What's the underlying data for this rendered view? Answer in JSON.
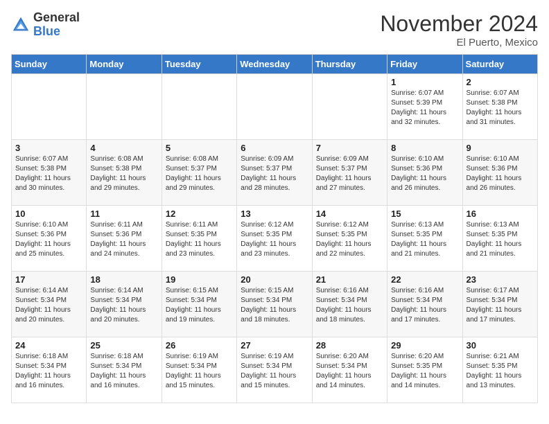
{
  "header": {
    "logo_general": "General",
    "logo_blue": "Blue",
    "month_title": "November 2024",
    "location": "El Puerto, Mexico"
  },
  "days_of_week": [
    "Sunday",
    "Monday",
    "Tuesday",
    "Wednesday",
    "Thursday",
    "Friday",
    "Saturday"
  ],
  "weeks": [
    [
      {
        "day": "",
        "info": ""
      },
      {
        "day": "",
        "info": ""
      },
      {
        "day": "",
        "info": ""
      },
      {
        "day": "",
        "info": ""
      },
      {
        "day": "",
        "info": ""
      },
      {
        "day": "1",
        "info": "Sunrise: 6:07 AM\nSunset: 5:39 PM\nDaylight: 11 hours\nand 32 minutes."
      },
      {
        "day": "2",
        "info": "Sunrise: 6:07 AM\nSunset: 5:38 PM\nDaylight: 11 hours\nand 31 minutes."
      }
    ],
    [
      {
        "day": "3",
        "info": "Sunrise: 6:07 AM\nSunset: 5:38 PM\nDaylight: 11 hours\nand 30 minutes."
      },
      {
        "day": "4",
        "info": "Sunrise: 6:08 AM\nSunset: 5:38 PM\nDaylight: 11 hours\nand 29 minutes."
      },
      {
        "day": "5",
        "info": "Sunrise: 6:08 AM\nSunset: 5:37 PM\nDaylight: 11 hours\nand 29 minutes."
      },
      {
        "day": "6",
        "info": "Sunrise: 6:09 AM\nSunset: 5:37 PM\nDaylight: 11 hours\nand 28 minutes."
      },
      {
        "day": "7",
        "info": "Sunrise: 6:09 AM\nSunset: 5:37 PM\nDaylight: 11 hours\nand 27 minutes."
      },
      {
        "day": "8",
        "info": "Sunrise: 6:10 AM\nSunset: 5:36 PM\nDaylight: 11 hours\nand 26 minutes."
      },
      {
        "day": "9",
        "info": "Sunrise: 6:10 AM\nSunset: 5:36 PM\nDaylight: 11 hours\nand 26 minutes."
      }
    ],
    [
      {
        "day": "10",
        "info": "Sunrise: 6:10 AM\nSunset: 5:36 PM\nDaylight: 11 hours\nand 25 minutes."
      },
      {
        "day": "11",
        "info": "Sunrise: 6:11 AM\nSunset: 5:36 PM\nDaylight: 11 hours\nand 24 minutes."
      },
      {
        "day": "12",
        "info": "Sunrise: 6:11 AM\nSunset: 5:35 PM\nDaylight: 11 hours\nand 23 minutes."
      },
      {
        "day": "13",
        "info": "Sunrise: 6:12 AM\nSunset: 5:35 PM\nDaylight: 11 hours\nand 23 minutes."
      },
      {
        "day": "14",
        "info": "Sunrise: 6:12 AM\nSunset: 5:35 PM\nDaylight: 11 hours\nand 22 minutes."
      },
      {
        "day": "15",
        "info": "Sunrise: 6:13 AM\nSunset: 5:35 PM\nDaylight: 11 hours\nand 21 minutes."
      },
      {
        "day": "16",
        "info": "Sunrise: 6:13 AM\nSunset: 5:35 PM\nDaylight: 11 hours\nand 21 minutes."
      }
    ],
    [
      {
        "day": "17",
        "info": "Sunrise: 6:14 AM\nSunset: 5:34 PM\nDaylight: 11 hours\nand 20 minutes."
      },
      {
        "day": "18",
        "info": "Sunrise: 6:14 AM\nSunset: 5:34 PM\nDaylight: 11 hours\nand 20 minutes."
      },
      {
        "day": "19",
        "info": "Sunrise: 6:15 AM\nSunset: 5:34 PM\nDaylight: 11 hours\nand 19 minutes."
      },
      {
        "day": "20",
        "info": "Sunrise: 6:15 AM\nSunset: 5:34 PM\nDaylight: 11 hours\nand 18 minutes."
      },
      {
        "day": "21",
        "info": "Sunrise: 6:16 AM\nSunset: 5:34 PM\nDaylight: 11 hours\nand 18 minutes."
      },
      {
        "day": "22",
        "info": "Sunrise: 6:16 AM\nSunset: 5:34 PM\nDaylight: 11 hours\nand 17 minutes."
      },
      {
        "day": "23",
        "info": "Sunrise: 6:17 AM\nSunset: 5:34 PM\nDaylight: 11 hours\nand 17 minutes."
      }
    ],
    [
      {
        "day": "24",
        "info": "Sunrise: 6:18 AM\nSunset: 5:34 PM\nDaylight: 11 hours\nand 16 minutes."
      },
      {
        "day": "25",
        "info": "Sunrise: 6:18 AM\nSunset: 5:34 PM\nDaylight: 11 hours\nand 16 minutes."
      },
      {
        "day": "26",
        "info": "Sunrise: 6:19 AM\nSunset: 5:34 PM\nDaylight: 11 hours\nand 15 minutes."
      },
      {
        "day": "27",
        "info": "Sunrise: 6:19 AM\nSunset: 5:34 PM\nDaylight: 11 hours\nand 15 minutes."
      },
      {
        "day": "28",
        "info": "Sunrise: 6:20 AM\nSunset: 5:34 PM\nDaylight: 11 hours\nand 14 minutes."
      },
      {
        "day": "29",
        "info": "Sunrise: 6:20 AM\nSunset: 5:35 PM\nDaylight: 11 hours\nand 14 minutes."
      },
      {
        "day": "30",
        "info": "Sunrise: 6:21 AM\nSunset: 5:35 PM\nDaylight: 11 hours\nand 13 minutes."
      }
    ]
  ]
}
